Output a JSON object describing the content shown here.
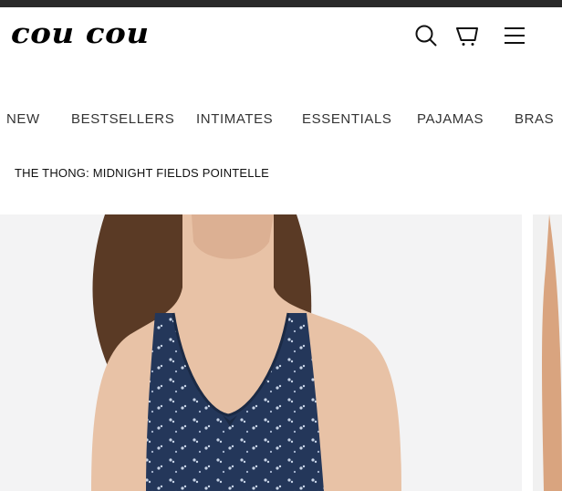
{
  "brand": {
    "logo_text": "cou cou"
  },
  "header": {
    "icons": [
      "search-icon",
      "cart-icon",
      "menu-icon"
    ]
  },
  "nav": {
    "items": [
      "NEW",
      "BESTSELLERS",
      "INTIMATES",
      "ESSENTIALS",
      "PAJAMAS",
      "BRAS"
    ]
  },
  "breadcrumb": {
    "title": "THE THONG: MIDNIGHT FIELDS POINTELLE"
  },
  "colors": {
    "fabric": "#24375a",
    "skin": "#e8c2a6",
    "hair": "#5a3a25",
    "backdrop": "#f3f3f4"
  }
}
